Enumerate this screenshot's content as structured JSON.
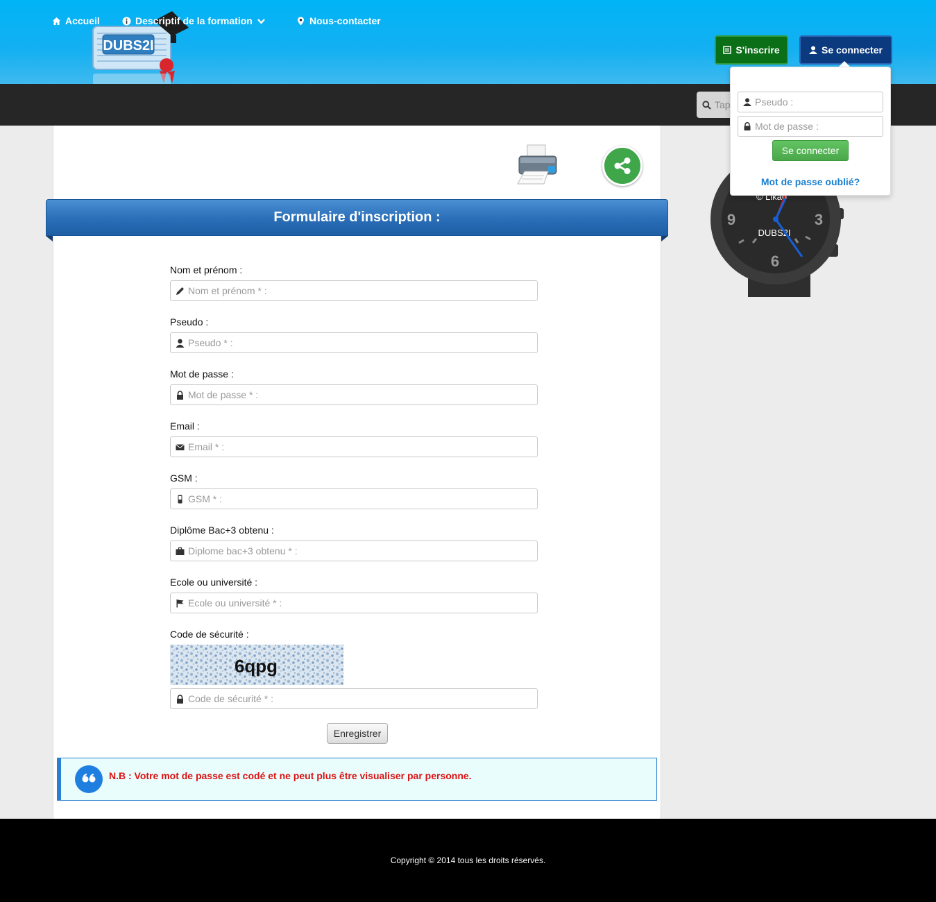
{
  "header": {
    "logo_text": "DUBS2I",
    "inscrire_label": "S'inscrire",
    "connect_label": "Se connecter"
  },
  "nav": {
    "items": [
      {
        "label": "Accueil",
        "icon": "home-icon"
      },
      {
        "label": "Descriptif de la formation",
        "icon": "info-icon"
      },
      {
        "label": "Nous-contacter",
        "icon": "map-marker-icon"
      }
    ],
    "search_placeholder": "Tap"
  },
  "form": {
    "title": "Formulaire d'inscription :",
    "fields": [
      {
        "label": "Nom et prénom :",
        "placeholder": "Nom et prénom * :",
        "icon": "pencil-icon"
      },
      {
        "label": "Pseudo :",
        "placeholder": "Pseudo * :",
        "icon": "user-icon"
      },
      {
        "label": "Mot de passe :",
        "placeholder": "Mot de passe * :",
        "icon": "lock-icon"
      },
      {
        "label": "Email :",
        "placeholder": "Email * :",
        "icon": "envelope-icon"
      },
      {
        "label": "GSM :",
        "placeholder": "GSM * :",
        "icon": "phone-icon"
      },
      {
        "label": "Diplôme Bac+3 obtenu :",
        "placeholder": "Diplome bac+3 obtenu * :",
        "icon": "briefcase-icon"
      },
      {
        "label": "Ecole ou université :",
        "placeholder": "Ecole ou université * :",
        "icon": "flag-icon"
      }
    ],
    "captcha": {
      "label": "Code de sécurité :",
      "code": "6qpg",
      "placeholder": "Code de sécurité * :"
    },
    "submit_label": "Enregistrer"
  },
  "note": {
    "text": "N.B : Votre mot de passe est codé et ne peut plus être visualiser par personne."
  },
  "login_dropdown": {
    "pseudo_placeholder": "Pseudo :",
    "password_placeholder": "Mot de passe :",
    "submit_label": "Se connecter",
    "forgot_link": "Mot de passe oublié?"
  },
  "watch": {
    "brand": "DUBS2I",
    "credit": "© Likao"
  },
  "footer": {
    "copyright": "Copyright © 2014 tous les droits réservés."
  },
  "colors": {
    "header_blue": "#00b4f5",
    "nav_dark": "#262626",
    "inscrire_green": "#0b6f17",
    "connect_navy": "#0c3a7e",
    "banner_blue": "#2a6eb8",
    "note_red": "#dd1111",
    "link_blue": "#1a7fd0"
  }
}
